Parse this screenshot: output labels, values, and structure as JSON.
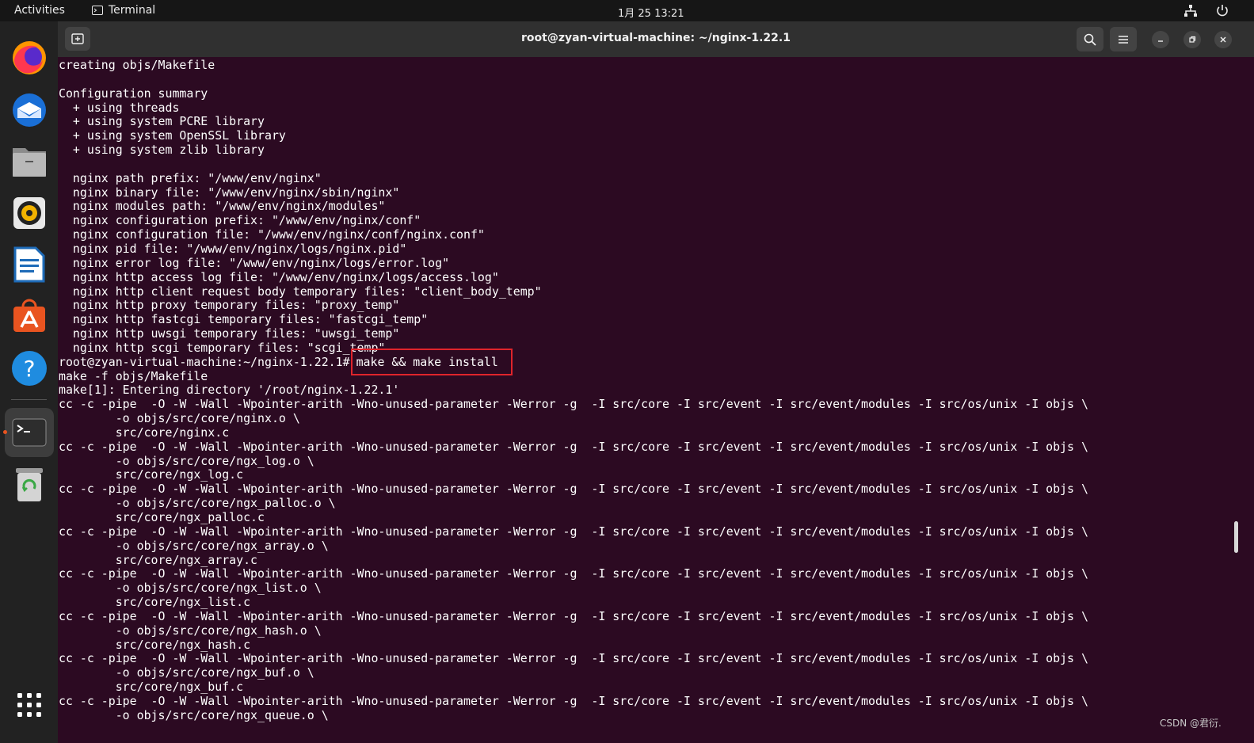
{
  "topbar": {
    "activities": "Activities",
    "app_name": "Terminal",
    "clock": "1月 25  13:21",
    "network_icon": "network-icon",
    "power_icon": "power-icon"
  },
  "dock": {
    "items": [
      {
        "name": "firefox",
        "icon": "firefox-icon"
      },
      {
        "name": "thunderbird",
        "icon": "thunderbird-icon"
      },
      {
        "name": "files",
        "icon": "files-icon"
      },
      {
        "name": "rhythmbox",
        "icon": "rhythmbox-icon"
      },
      {
        "name": "libreoffice-writer",
        "icon": "writer-icon"
      },
      {
        "name": "ubuntu-software",
        "icon": "software-icon"
      },
      {
        "name": "help",
        "icon": "help-icon"
      },
      {
        "name": "terminal",
        "icon": "terminal-icon",
        "active": true
      },
      {
        "name": "trash",
        "icon": "trash-icon"
      },
      {
        "name": "show-apps",
        "icon": "apps-grid-icon"
      }
    ],
    "accent": "#e95420"
  },
  "window": {
    "title": "root@zyan-virtual-machine: ~/nginx-1.22.1"
  },
  "terminal": {
    "pre_lines": "creating objs/Makefile\n\nConfiguration summary\n  + using threads\n  + using system PCRE library\n  + using system OpenSSL library\n  + using system zlib library\n\n  nginx path prefix: \"/www/env/nginx\"\n  nginx binary file: \"/www/env/nginx/sbin/nginx\"\n  nginx modules path: \"/www/env/nginx/modules\"\n  nginx configuration prefix: \"/www/env/nginx/conf\"\n  nginx configuration file: \"/www/env/nginx/conf/nginx.conf\"\n  nginx pid file: \"/www/env/nginx/logs/nginx.pid\"\n  nginx error log file: \"/www/env/nginx/logs/error.log\"\n  nginx http access log file: \"/www/env/nginx/logs/access.log\"\n  nginx http client request body temporary files: \"client_body_temp\"\n  nginx http proxy temporary files: \"proxy_temp\"\n  nginx http fastcgi temporary files: \"fastcgi_temp\"\n  nginx http uwsgi temporary files: \"uwsgi_temp\"\n  nginx http scgi temporary files: \"scgi_temp\"\n",
    "prompt": "root@zyan-virtual-machine:~/nginx-1.22.1#",
    "command": "make && make install",
    "post_lines": "make -f objs/Makefile\nmake[1]: Entering directory '/root/nginx-1.22.1'\ncc -c -pipe  -O -W -Wall -Wpointer-arith -Wno-unused-parameter -Werror -g  -I src/core -I src/event -I src/event/modules -I src/os/unix -I objs \\\n        -o objs/src/core/nginx.o \\\n        src/core/nginx.c\ncc -c -pipe  -O -W -Wall -Wpointer-arith -Wno-unused-parameter -Werror -g  -I src/core -I src/event -I src/event/modules -I src/os/unix -I objs \\\n        -o objs/src/core/ngx_log.o \\\n        src/core/ngx_log.c\ncc -c -pipe  -O -W -Wall -Wpointer-arith -Wno-unused-parameter -Werror -g  -I src/core -I src/event -I src/event/modules -I src/os/unix -I objs \\\n        -o objs/src/core/ngx_palloc.o \\\n        src/core/ngx_palloc.c\ncc -c -pipe  -O -W -Wall -Wpointer-arith -Wno-unused-parameter -Werror -g  -I src/core -I src/event -I src/event/modules -I src/os/unix -I objs \\\n        -o objs/src/core/ngx_array.o \\\n        src/core/ngx_array.c\ncc -c -pipe  -O -W -Wall -Wpointer-arith -Wno-unused-parameter -Werror -g  -I src/core -I src/event -I src/event/modules -I src/os/unix -I objs \\\n        -o objs/src/core/ngx_list.o \\\n        src/core/ngx_list.c\ncc -c -pipe  -O -W -Wall -Wpointer-arith -Wno-unused-parameter -Werror -g  -I src/core -I src/event -I src/event/modules -I src/os/unix -I objs \\\n        -o objs/src/core/ngx_hash.o \\\n        src/core/ngx_hash.c\ncc -c -pipe  -O -W -Wall -Wpointer-arith -Wno-unused-parameter -Werror -g  -I src/core -I src/event -I src/event/modules -I src/os/unix -I objs \\\n        -o objs/src/core/ngx_buf.o \\\n        src/core/ngx_buf.c\ncc -c -pipe  -O -W -Wall -Wpointer-arith -Wno-unused-parameter -Werror -g  -I src/core -I src/event -I src/event/modules -I src/os/unix -I objs \\\n        -o objs/src/core/ngx_queue.o \\",
    "background": "#2c0a22",
    "highlight_color": "#e0242b"
  },
  "watermark": "CSDN @君衍."
}
